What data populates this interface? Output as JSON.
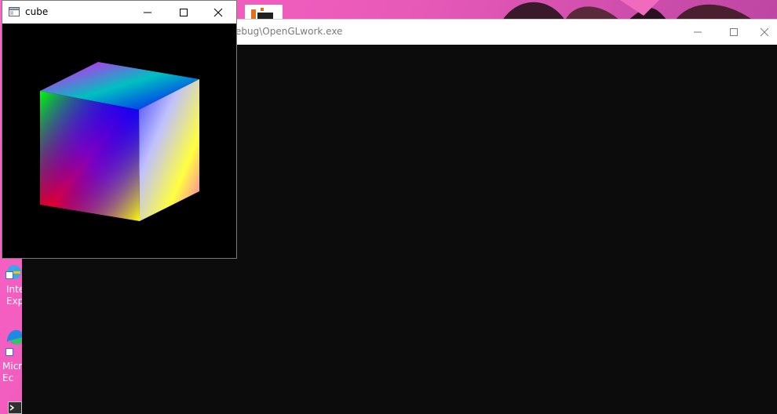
{
  "cube_window": {
    "title": "cube",
    "buttons": {
      "minimize": "minimize",
      "maximize": "maximize",
      "close": "close"
    }
  },
  "console_window": {
    "title": "ebug\\OpenGLwork.exe",
    "buttons": {
      "minimize": "minimize",
      "maximize": "maximize",
      "close": "close"
    }
  },
  "desktop": {
    "icons": [
      {
        "name": "internet-explorer",
        "label": "Inte\nExp"
      },
      {
        "name": "microsoft-edge",
        "label": "Micr\nEc"
      },
      {
        "name": "terminal",
        "label": ""
      }
    ]
  },
  "colors": {
    "cube_corner_red": "#ff0000",
    "cube_corner_green": "#00ff00",
    "cube_corner_blue": "#0000ff",
    "cube_corner_yellow": "#ffff00",
    "cube_corner_magenta": "#ff00ff",
    "cube_corner_white": "#ffffff",
    "console_bg": "#0c0c0c"
  }
}
